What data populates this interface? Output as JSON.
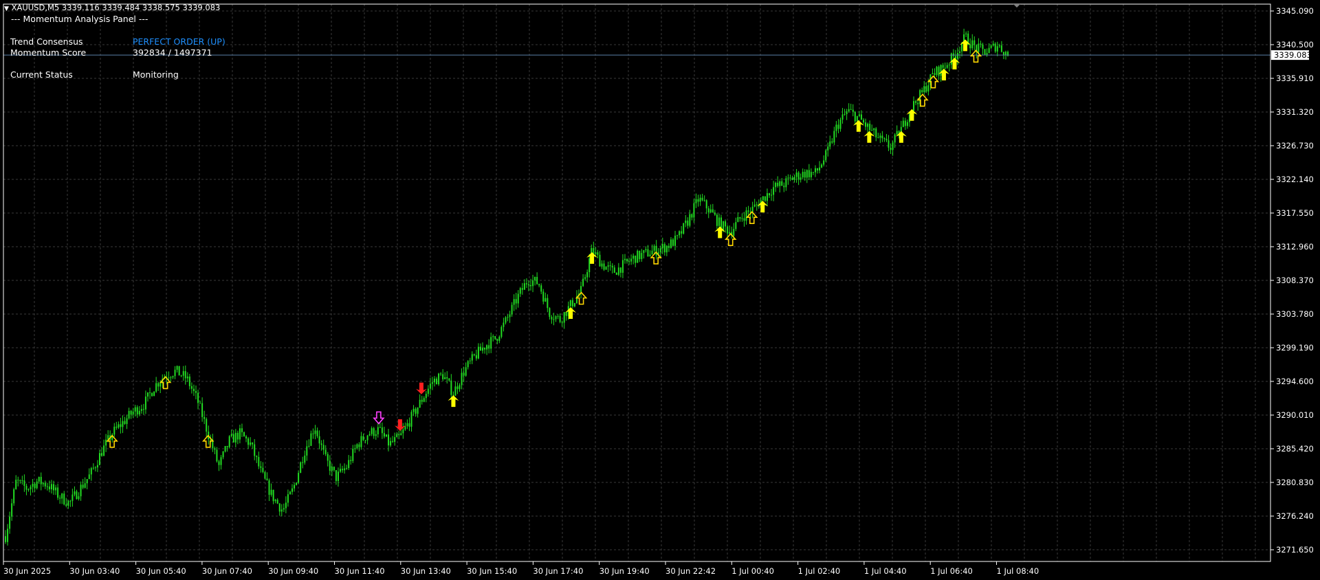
{
  "symbol_bar": {
    "menu_glyph": "▼",
    "symbol": "XAUUSD,M5",
    "ohlc": "3339.116 3339.484 3338.575 3339.083"
  },
  "panel": {
    "title": "--- Momentum Analysis Panel ---",
    "rows": [
      {
        "label": "Trend Consensus",
        "value": "PERFECT ORDER (UP)",
        "value_color": "#1e90ff"
      },
      {
        "label": "Momentum Score",
        "value": "392834 / 1497371",
        "value_color": "#ffffff"
      },
      {
        "label": "Current Status",
        "value": "Monitoring",
        "value_color": "#ffffff"
      }
    ]
  },
  "colors": {
    "background": "#000000",
    "grid": "#3a3a3a",
    "candles": "#22dd22",
    "bid_line": "#5a7fa8",
    "up_arrow_filled": "#ffff00",
    "up_arrow_outline": "#ffd700",
    "down_arrow_filled": "#ff2020",
    "down_arrow_outline": "#ff40ff",
    "axis_text": "#ffffff",
    "border": "#ffffff"
  },
  "icons": {
    "symbol_menu": "triangle-down-icon",
    "up_signal": "up-arrow-icon",
    "down_signal": "down-arrow-icon"
  },
  "chart_data": {
    "type": "candlestick",
    "price_axis": {
      "labels": [
        "3345.090",
        "3340.500",
        "3335.910",
        "3331.320",
        "3326.730",
        "3322.140",
        "3317.550",
        "3312.960",
        "3308.370",
        "3303.780",
        "3299.190",
        "3294.600",
        "3290.010",
        "3285.420",
        "3280.830",
        "3276.240",
        "3271.650"
      ],
      "range": [
        3271.65,
        3345.09
      ],
      "current_price": "3339.083"
    },
    "time_axis": {
      "labels": [
        "30 Jun 2025",
        "30 Jun 03:40",
        "30 Jun 05:40",
        "30 Jun 07:40",
        "30 Jun 09:40",
        "30 Jun 11:40",
        "30 Jun 13:40",
        "30 Jun 15:40",
        "30 Jun 17:40",
        "30 Jun 19:40",
        "30 Jun 22:42",
        "1 Jul 00:40",
        "1 Jul 02:40",
        "1 Jul 04:40",
        "1 Jul 06:40",
        "1 Jul 08:40"
      ]
    },
    "price_path": [
      [
        0,
        3273.5
      ],
      [
        1,
        3281
      ],
      [
        2,
        3280
      ],
      [
        3,
        3281
      ],
      [
        4,
        3280.5
      ],
      [
        5,
        3279
      ],
      [
        6,
        3278
      ],
      [
        7,
        3280
      ],
      [
        8,
        3282
      ],
      [
        9,
        3285
      ],
      [
        10,
        3287.5
      ],
      [
        11,
        3289
      ],
      [
        12,
        3290.5
      ],
      [
        13,
        3291.5
      ],
      [
        14,
        3294
      ],
      [
        15,
        3295.5
      ],
      [
        16,
        3296
      ],
      [
        17,
        3295
      ],
      [
        18,
        3292
      ],
      [
        19,
        3287.5
      ],
      [
        20,
        3283
      ],
      [
        21,
        3286.5
      ],
      [
        22,
        3287.5
      ],
      [
        23,
        3286
      ],
      [
        24,
        3282
      ],
      [
        25,
        3279
      ],
      [
        26,
        3277
      ],
      [
        27,
        3280
      ],
      [
        28,
        3285
      ],
      [
        29,
        3288.5
      ],
      [
        30,
        3284
      ],
      [
        31,
        3281.5
      ],
      [
        32,
        3283
      ],
      [
        33,
        3286
      ],
      [
        34,
        3287.5
      ],
      [
        35,
        3288
      ],
      [
        36,
        3286
      ],
      [
        37,
        3287
      ],
      [
        38,
        3289.5
      ],
      [
        39,
        3292
      ],
      [
        40,
        3294.5
      ],
      [
        41,
        3295.5
      ],
      [
        42,
        3293
      ],
      [
        43,
        3296
      ],
      [
        44,
        3298
      ],
      [
        45,
        3299.5
      ],
      [
        46,
        3300.5
      ],
      [
        47,
        3303
      ],
      [
        48,
        3306
      ],
      [
        49,
        3308.5
      ],
      [
        50,
        3308
      ],
      [
        51,
        3304
      ],
      [
        52,
        3303
      ],
      [
        53,
        3305
      ],
      [
        54,
        3307
      ],
      [
        55,
        3312.5
      ],
      [
        56,
        3310.5
      ],
      [
        57,
        3309.5
      ],
      [
        58,
        3310.5
      ],
      [
        59,
        3311.5
      ],
      [
        60,
        3312
      ],
      [
        61,
        3312.5
      ],
      [
        62,
        3313
      ],
      [
        63,
        3314
      ],
      [
        64,
        3316.5
      ],
      [
        65,
        3319.5
      ],
      [
        66,
        3318
      ],
      [
        67,
        3316
      ],
      [
        68,
        3315
      ],
      [
        69,
        3317
      ],
      [
        70,
        3318
      ],
      [
        71,
        3319.5
      ],
      [
        72,
        3321
      ],
      [
        73,
        3321.5
      ],
      [
        74,
        3322.5
      ],
      [
        75,
        3323
      ],
      [
        76,
        3323
      ],
      [
        77,
        3325.5
      ],
      [
        78,
        3329.5
      ],
      [
        79,
        3331.5
      ],
      [
        80,
        3330.5
      ],
      [
        81,
        3329
      ],
      [
        82,
        3327.5
      ],
      [
        83,
        3326.5
      ],
      [
        84,
        3329
      ],
      [
        85,
        3332
      ],
      [
        86,
        3334
      ],
      [
        87,
        3336.5
      ],
      [
        88,
        3337.5
      ],
      [
        89,
        3339
      ],
      [
        90,
        3341.5
      ],
      [
        91,
        3340
      ],
      [
        92,
        3339.5
      ],
      [
        93,
        3340.5
      ],
      [
        94,
        3339.1
      ]
    ],
    "signals": [
      {
        "bar": 10,
        "type": "up_outline"
      },
      {
        "bar": 15,
        "type": "up_outline"
      },
      {
        "bar": 19,
        "type": "up_outline"
      },
      {
        "bar": 35,
        "type": "down_outline"
      },
      {
        "bar": 37,
        "type": "down_filled"
      },
      {
        "bar": 39,
        "type": "down_filled"
      },
      {
        "bar": 42,
        "type": "up_filled"
      },
      {
        "bar": 53,
        "type": "up_filled"
      },
      {
        "bar": 54,
        "type": "up_outline"
      },
      {
        "bar": 55,
        "type": "up_filled"
      },
      {
        "bar": 61,
        "type": "up_outline"
      },
      {
        "bar": 67,
        "type": "up_filled"
      },
      {
        "bar": 68,
        "type": "up_outline"
      },
      {
        "bar": 70,
        "type": "up_outline"
      },
      {
        "bar": 71,
        "type": "up_filled"
      },
      {
        "bar": 80,
        "type": "up_filled"
      },
      {
        "bar": 81,
        "type": "up_filled"
      },
      {
        "bar": 84,
        "type": "up_filled"
      },
      {
        "bar": 85,
        "type": "up_filled"
      },
      {
        "bar": 86,
        "type": "up_outline"
      },
      {
        "bar": 87,
        "type": "up_outline"
      },
      {
        "bar": 88,
        "type": "up_filled"
      },
      {
        "bar": 89,
        "type": "up_filled"
      },
      {
        "bar": 90,
        "type": "up_filled"
      },
      {
        "bar": 91,
        "type": "up_outline"
      }
    ]
  }
}
